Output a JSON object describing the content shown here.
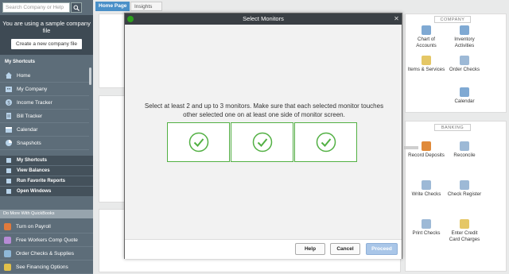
{
  "sidebar": {
    "search_placeholder": "Search Company or Help",
    "sample_notice": "You are using a sample company file",
    "create_button": "Create a new company file",
    "my_shortcuts_header": "My Shortcuts",
    "nav_items": [
      {
        "label": "Home",
        "icon": "home-icon",
        "color": "#8fb8d8"
      },
      {
        "label": "My Company",
        "icon": "company-icon",
        "color": "#8fb8d8"
      },
      {
        "label": "Income Tracker",
        "icon": "income-tracker-icon",
        "color": "#8fb8d8"
      },
      {
        "label": "Bill Tracker",
        "icon": "bill-tracker-icon",
        "color": "#8fb8d8"
      },
      {
        "label": "Calendar",
        "icon": "calendar-icon",
        "color": "#8fb8d8"
      },
      {
        "label": "Snapshots",
        "icon": "snapshots-icon",
        "color": "#8fb8d8"
      }
    ],
    "shortcut_sections": [
      "My Shortcuts",
      "View Balances",
      "Run Favorite Reports",
      "Open Windows"
    ],
    "more_header": "Do More With QuickBooks",
    "more_items": [
      {
        "label": "Turn on Payroll",
        "icon": "payroll-icon",
        "color": "#e07a3c"
      },
      {
        "label": "Free Workers Comp Quote",
        "icon": "plus-icon",
        "color": "#b78bd6"
      },
      {
        "label": "Order Checks & Supplies",
        "icon": "checks-icon",
        "color": "#8fb8d8"
      },
      {
        "label": "See Financing Options",
        "icon": "financing-icon",
        "color": "#e0c04a"
      }
    ]
  },
  "tabs": [
    "Home Page",
    "Insights"
  ],
  "company_panel": {
    "title": "COMPANY",
    "items": [
      {
        "label": "Chart of Accounts",
        "icon": "chart-of-accounts-icon"
      },
      {
        "label": "Inventory Activities",
        "icon": "inventory-icon"
      },
      {
        "label": "Items & Services",
        "icon": "items-services-icon"
      },
      {
        "label": "Order Checks",
        "icon": "order-checks-icon"
      },
      {
        "label": "Calendar",
        "icon": "calendar-icon"
      }
    ]
  },
  "banking_panel": {
    "title": "BANKING",
    "items": [
      {
        "label": "Record Deposits",
        "icon": "record-deposits-icon"
      },
      {
        "label": "Reconcile",
        "icon": "reconcile-icon"
      },
      {
        "label": "Write Checks",
        "icon": "write-checks-icon"
      },
      {
        "label": "Check Register",
        "icon": "check-register-icon"
      },
      {
        "label": "Print Checks",
        "icon": "print-checks-icon"
      },
      {
        "label": "Enter Credit Card Charges",
        "icon": "credit-card-icon"
      }
    ]
  },
  "dialog": {
    "title": "Select Monitors",
    "instructions": "Select at least 2 and up to 3 monitors. Make sure that each selected monitor touches other selected one on at least one side of monitor screen.",
    "monitors": [
      {
        "selected": true,
        "icon": "check-circle-icon"
      },
      {
        "selected": true,
        "icon": "check-circle-icon"
      },
      {
        "selected": true,
        "icon": "check-circle-icon"
      }
    ],
    "help_button": "Help",
    "cancel_button": "Cancel",
    "proceed_button": "Proceed"
  },
  "colors": {
    "sidebar_bg": "#5d6d79",
    "dialog_title_bg": "#3a3f44",
    "selected_green": "#52b043",
    "proceed_bg": "#a9c6e8"
  }
}
